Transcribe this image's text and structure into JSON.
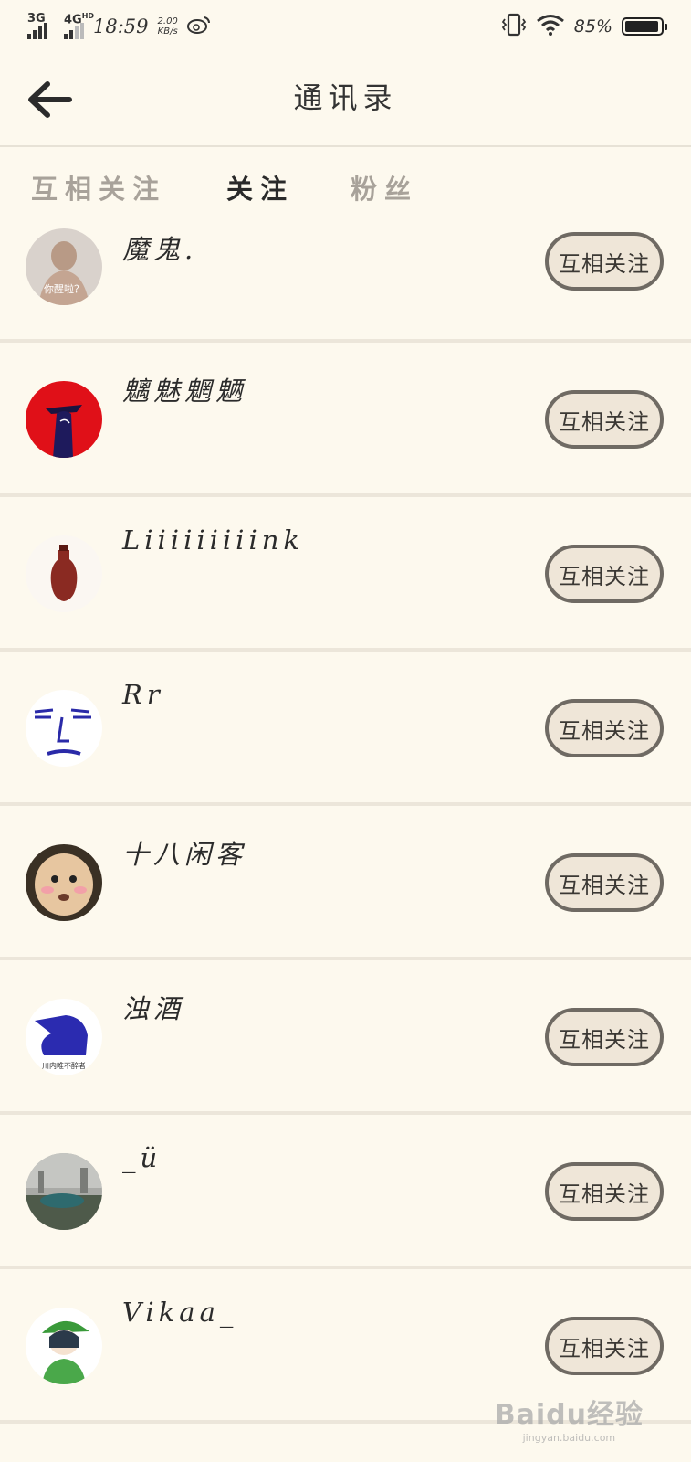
{
  "status_bar": {
    "network1": "3G",
    "network2": "4G",
    "network2_suffix": "HD",
    "time": "18:59",
    "speed_value": "2.00",
    "speed_unit": "KB/s",
    "battery_percent_text": "85%",
    "battery_level": 0.85
  },
  "header": {
    "title": "通讯录"
  },
  "tabs": [
    {
      "label": "互相关注",
      "active": false
    },
    {
      "label": "关注",
      "active": true
    },
    {
      "label": "粉丝",
      "active": false
    }
  ],
  "contacts": [
    {
      "name": "魔鬼.",
      "button": "互相关注",
      "avatar_caption": "你醒啦？"
    },
    {
      "name": "魑魅魍魉",
      "button": "互相关注"
    },
    {
      "name": "Liiiiiiiiink",
      "button": "互相关注"
    },
    {
      "name": "Rr",
      "button": "互相关注"
    },
    {
      "name": "十八闲客",
      "button": "互相关注"
    },
    {
      "name": "浊酒",
      "button": "互相关注",
      "avatar_caption": "川内唯不醉者"
    },
    {
      "name": "_ü",
      "button": "互相关注"
    },
    {
      "name": "Vikaa_",
      "button": "互相关注"
    }
  ],
  "watermark": {
    "brand": "Baidu经验",
    "url": "jingyan.baidu.com"
  },
  "colors": {
    "background": "#fdf9ee",
    "button_fill": "#efe6d8",
    "button_border": "#6f6a63",
    "tab_inactive": "#a8a29a"
  }
}
